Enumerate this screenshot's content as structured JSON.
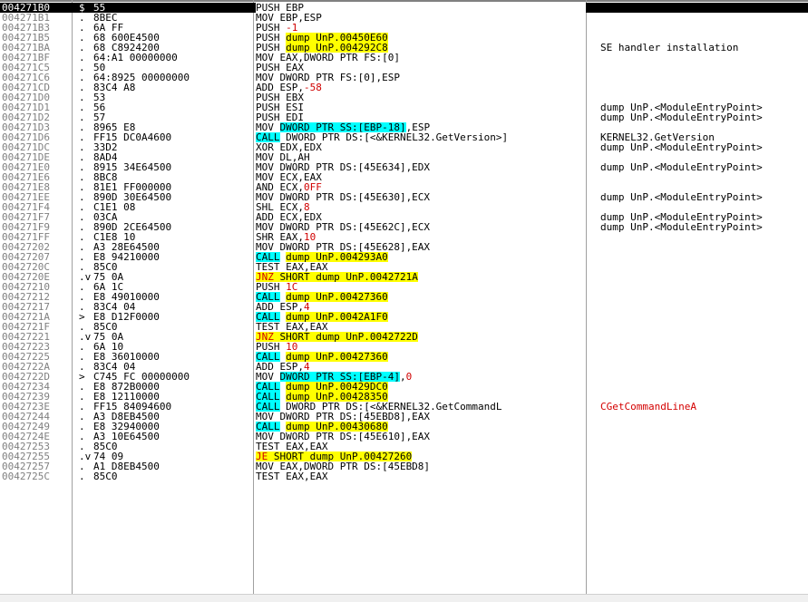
{
  "rows": [
    {
      "addr": "004271B0",
      "mark": "$",
      "hex": "55",
      "dis": [
        [
          "PUSH EBP",
          ""
        ]
      ],
      "comment": "",
      "sel": true
    },
    {
      "addr": "004271B1",
      "mark": ".",
      "hex": "8BEC",
      "dis": [
        [
          "MOV EBP,ESP",
          ""
        ]
      ],
      "comment": ""
    },
    {
      "addr": "004271B3",
      "mark": ".",
      "hex": "6A FF",
      "dis": [
        [
          "PUSH ",
          ""
        ],
        [
          "-1",
          "red"
        ]
      ],
      "comment": ""
    },
    {
      "addr": "004271B5",
      "mark": ".",
      "hex": "68 600E4500",
      "dis": [
        [
          "PUSH ",
          ""
        ],
        [
          "dump_UnP.00450E60",
          "yel"
        ]
      ],
      "comment": ""
    },
    {
      "addr": "004271BA",
      "mark": ".",
      "hex": "68 C8924200",
      "dis": [
        [
          "PUSH ",
          ""
        ],
        [
          "dump_UnP.004292C8",
          "yel"
        ]
      ],
      "comment": "SE handler installation"
    },
    {
      "addr": "004271BF",
      "mark": ".",
      "hex": "64:A1 00000000",
      "dis": [
        [
          "MOV EAX,DWORD PTR FS:[0]",
          ""
        ]
      ],
      "comment": ""
    },
    {
      "addr": "004271C5",
      "mark": ".",
      "hex": "50",
      "dis": [
        [
          "PUSH EAX",
          ""
        ]
      ],
      "comment": ""
    },
    {
      "addr": "004271C6",
      "mark": ".",
      "hex": "64:8925 00000000",
      "dis": [
        [
          "MOV DWORD PTR FS:[0],ESP",
          ""
        ]
      ],
      "comment": ""
    },
    {
      "addr": "004271CD",
      "mark": ".",
      "hex": "83C4 A8",
      "dis": [
        [
          "ADD ESP,",
          ""
        ],
        [
          "-58",
          "red"
        ]
      ],
      "comment": ""
    },
    {
      "addr": "004271D0",
      "mark": ".",
      "hex": "53",
      "dis": [
        [
          "PUSH EBX",
          ""
        ]
      ],
      "comment": ""
    },
    {
      "addr": "004271D1",
      "mark": ".",
      "hex": "56",
      "dis": [
        [
          "PUSH ESI",
          ""
        ]
      ],
      "comment": "dump_UnP.<ModuleEntryPoint>"
    },
    {
      "addr": "004271D2",
      "mark": ".",
      "hex": "57",
      "dis": [
        [
          "PUSH EDI",
          ""
        ]
      ],
      "comment": "dump_UnP.<ModuleEntryPoint>"
    },
    {
      "addr": "004271D3",
      "mark": ".",
      "hex": "8965 E8",
      "dis": [
        [
          "MOV ",
          ""
        ],
        [
          "DWORD PTR SS:[EBP-18]",
          "cyan"
        ],
        [
          ",ESP",
          ""
        ]
      ],
      "comment": ""
    },
    {
      "addr": "004271D6",
      "mark": ".",
      "hex": "FF15 DC0A4600",
      "dis": [
        [
          "CALL",
          "cyan"
        ],
        [
          " DWORD PTR DS:[<&KERNEL32.GetVersion>]",
          ""
        ]
      ],
      "comment": "KERNEL32.GetVersion"
    },
    {
      "addr": "004271DC",
      "mark": ".",
      "hex": "33D2",
      "dis": [
        [
          "XOR EDX,EDX",
          ""
        ]
      ],
      "comment": "dump_UnP.<ModuleEntryPoint>"
    },
    {
      "addr": "004271DE",
      "mark": ".",
      "hex": "8AD4",
      "dis": [
        [
          "MOV DL,AH",
          ""
        ]
      ],
      "comment": ""
    },
    {
      "addr": "004271E0",
      "mark": ".",
      "hex": "8915 34E64500",
      "dis": [
        [
          "MOV DWORD PTR DS:[45E634],EDX",
          ""
        ]
      ],
      "comment": "dump_UnP.<ModuleEntryPoint>"
    },
    {
      "addr": "004271E6",
      "mark": ".",
      "hex": "8BC8",
      "dis": [
        [
          "MOV ECX,EAX",
          ""
        ]
      ],
      "comment": ""
    },
    {
      "addr": "004271E8",
      "mark": ".",
      "hex": "81E1 FF000000",
      "dis": [
        [
          "AND ECX,",
          ""
        ],
        [
          "0FF",
          "red"
        ]
      ],
      "comment": ""
    },
    {
      "addr": "004271EE",
      "mark": ".",
      "hex": "890D 30E64500",
      "dis": [
        [
          "MOV DWORD PTR DS:[45E630],ECX",
          ""
        ]
      ],
      "comment": "dump_UnP.<ModuleEntryPoint>"
    },
    {
      "addr": "004271F4",
      "mark": ".",
      "hex": "C1E1 08",
      "dis": [
        [
          "SHL ECX,",
          ""
        ],
        [
          "8",
          "red"
        ]
      ],
      "comment": ""
    },
    {
      "addr": "004271F7",
      "mark": ".",
      "hex": "03CA",
      "dis": [
        [
          "ADD ECX,EDX",
          ""
        ]
      ],
      "comment": "dump_UnP.<ModuleEntryPoint>"
    },
    {
      "addr": "004271F9",
      "mark": ".",
      "hex": "890D 2CE64500",
      "dis": [
        [
          "MOV DWORD PTR DS:[45E62C],ECX",
          ""
        ]
      ],
      "comment": "dump_UnP.<ModuleEntryPoint>"
    },
    {
      "addr": "004271FF",
      "mark": ".",
      "hex": "C1E8 10",
      "dis": [
        [
          "SHR EAX,",
          ""
        ],
        [
          "10",
          "red"
        ]
      ],
      "comment": ""
    },
    {
      "addr": "00427202",
      "mark": ".",
      "hex": "A3 28E64500",
      "dis": [
        [
          "MOV DWORD PTR DS:[45E628],EAX",
          ""
        ]
      ],
      "comment": ""
    },
    {
      "addr": "00427207",
      "mark": ".",
      "hex": "E8 94210000",
      "dis": [
        [
          "CALL",
          "cyan"
        ],
        [
          " ",
          ""
        ],
        [
          "dump_UnP.004293A0",
          "yel"
        ]
      ],
      "comment": ""
    },
    {
      "addr": "0042720C",
      "mark": ".",
      "hex": "85C0",
      "dis": [
        [
          "TEST EAX,EAX",
          ""
        ]
      ],
      "comment": ""
    },
    {
      "addr": "0042720E",
      "mark": ".v",
      "hex": "75 0A",
      "dis": [
        [
          "JNZ",
          "hy red"
        ],
        [
          " SHORT dump_UnP.0042721A",
          "yel"
        ]
      ],
      "comment": ""
    },
    {
      "addr": "00427210",
      "mark": ".",
      "hex": "6A 1C",
      "dis": [
        [
          "PUSH ",
          ""
        ],
        [
          "1C",
          "red"
        ]
      ],
      "comment": ""
    },
    {
      "addr": "00427212",
      "mark": ".",
      "hex": "E8 49010000",
      "dis": [
        [
          "CALL",
          "cyan"
        ],
        [
          " ",
          ""
        ],
        [
          "dump_UnP.00427360",
          "yel"
        ]
      ],
      "comment": ""
    },
    {
      "addr": "00427217",
      "mark": ".",
      "hex": "83C4 04",
      "dis": [
        [
          "ADD ESP,",
          ""
        ],
        [
          "4",
          "red"
        ]
      ],
      "comment": ""
    },
    {
      "addr": "0042721A",
      "mark": ">",
      "hex": "E8 D12F0000",
      "dis": [
        [
          "CALL",
          "cyan"
        ],
        [
          " ",
          ""
        ],
        [
          "dump_UnP.0042A1F0",
          "yel"
        ]
      ],
      "comment": ""
    },
    {
      "addr": "0042721F",
      "mark": ".",
      "hex": "85C0",
      "dis": [
        [
          "TEST EAX,EAX",
          ""
        ]
      ],
      "comment": ""
    },
    {
      "addr": "00427221",
      "mark": ".v",
      "hex": "75 0A",
      "dis": [
        [
          "JNZ",
          "hy red"
        ],
        [
          " SHORT dump_UnP.0042722D",
          "yel"
        ]
      ],
      "comment": ""
    },
    {
      "addr": "00427223",
      "mark": ".",
      "hex": "6A 10",
      "dis": [
        [
          "PUSH ",
          ""
        ],
        [
          "10",
          "red"
        ]
      ],
      "comment": ""
    },
    {
      "addr": "00427225",
      "mark": ".",
      "hex": "E8 36010000",
      "dis": [
        [
          "CALL",
          "cyan"
        ],
        [
          " ",
          ""
        ],
        [
          "dump_UnP.00427360",
          "yel"
        ]
      ],
      "comment": ""
    },
    {
      "addr": "0042722A",
      "mark": ".",
      "hex": "83C4 04",
      "dis": [
        [
          "ADD ESP,",
          ""
        ],
        [
          "4",
          "red"
        ]
      ],
      "comment": ""
    },
    {
      "addr": "0042722D",
      "mark": ">",
      "hex": "C745 FC 00000000",
      "dis": [
        [
          "MOV ",
          ""
        ],
        [
          "DWORD PTR SS:[EBP-4]",
          "cyan"
        ],
        [
          ",",
          ""
        ],
        [
          "0",
          "red"
        ]
      ],
      "comment": ""
    },
    {
      "addr": "00427234",
      "mark": ".",
      "hex": "E8 872B0000",
      "dis": [
        [
          "CALL",
          "cyan"
        ],
        [
          " ",
          ""
        ],
        [
          "dump_UnP.00429DC0",
          "yel"
        ]
      ],
      "comment": ""
    },
    {
      "addr": "00427239",
      "mark": ".",
      "hex": "E8 12110000",
      "dis": [
        [
          "CALL",
          "cyan"
        ],
        [
          " ",
          ""
        ],
        [
          "dump_UnP.00428350",
          "yel"
        ]
      ],
      "comment": ""
    },
    {
      "addr": "0042723E",
      "mark": ".",
      "hex": "FF15 84094600",
      "dis": [
        [
          "CALL",
          "cyan"
        ],
        [
          " DWORD PTR DS:[<&KERNEL32.GetCommandL",
          ""
        ]
      ],
      "comment": "CGetCommandLineA",
      "commentColor": "red"
    },
    {
      "addr": "00427244",
      "mark": ".",
      "hex": "A3 D8EB4500",
      "dis": [
        [
          "MOV DWORD PTR DS:[45EBD8],EAX",
          ""
        ]
      ],
      "comment": ""
    },
    {
      "addr": "00427249",
      "mark": ".",
      "hex": "E8 32940000",
      "dis": [
        [
          "CALL",
          "cyan"
        ],
        [
          " ",
          ""
        ],
        [
          "dump_UnP.00430680",
          "yel"
        ]
      ],
      "comment": ""
    },
    {
      "addr": "0042724E",
      "mark": ".",
      "hex": "A3 10E64500",
      "dis": [
        [
          "MOV DWORD PTR DS:[45E610],EAX",
          ""
        ]
      ],
      "comment": ""
    },
    {
      "addr": "00427253",
      "mark": ".",
      "hex": "85C0",
      "dis": [
        [
          "TEST EAX,EAX",
          ""
        ]
      ],
      "comment": ""
    },
    {
      "addr": "00427255",
      "mark": ".v",
      "hex": "74 09",
      "dis": [
        [
          "JE",
          "hy red"
        ],
        [
          " SHORT dump_UnP.00427260",
          "yel"
        ]
      ],
      "comment": ""
    },
    {
      "addr": "00427257",
      "mark": ".",
      "hex": "A1 D8EB4500",
      "dis": [
        [
          "MOV EAX,DWORD PTR DS:[45EBD8]",
          ""
        ]
      ],
      "comment": ""
    },
    {
      "addr": "0042725C",
      "mark": ".",
      "hex": "85C0",
      "dis": [
        [
          "TEST EAX,EAX",
          ""
        ]
      ],
      "comment": ""
    }
  ]
}
